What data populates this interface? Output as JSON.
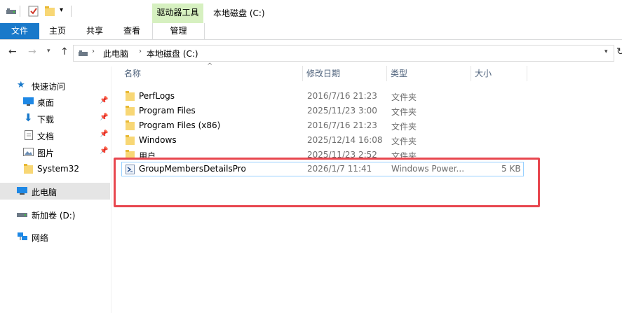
{
  "ribbon": {
    "context_header": "驱动器工具",
    "tabs": [
      "文件",
      "主页",
      "共享",
      "查看"
    ],
    "context_tab": "管理"
  },
  "window": {
    "title": "本地磁盘 (C:)"
  },
  "address": {
    "crumbs": [
      "此电脑",
      "本地磁盘 (C:)"
    ]
  },
  "nav": {
    "quick_access": "快速访问",
    "items": [
      {
        "label": "桌面",
        "icon": "desktop-icon",
        "pinned": true
      },
      {
        "label": "下载",
        "icon": "download-icon",
        "pinned": true
      },
      {
        "label": "文档",
        "icon": "documents-icon",
        "pinned": true
      },
      {
        "label": "图片",
        "icon": "pictures-icon",
        "pinned": true
      },
      {
        "label": "System32",
        "icon": "folder-icon",
        "pinned": false
      }
    ],
    "this_pc": "此电脑",
    "drive_d": "新加卷 (D:)",
    "network": "网络"
  },
  "columns": {
    "name": "名称",
    "modified": "修改日期",
    "type": "类型",
    "size": "大小"
  },
  "files": [
    {
      "name": "PerfLogs",
      "modified": "2016/7/16 21:23",
      "type": "文件夹",
      "size": ""
    },
    {
      "name": "Program Files",
      "modified": "2025/11/23 3:00",
      "type": "文件夹",
      "size": ""
    },
    {
      "name": "Program Files (x86)",
      "modified": "2016/7/16 21:23",
      "type": "文件夹",
      "size": ""
    },
    {
      "name": "Windows",
      "modified": "2025/12/14 16:08",
      "type": "文件夹",
      "size": ""
    },
    {
      "name": "用户",
      "modified": "2025/11/23 2:52",
      "type": "文件夹",
      "size": ""
    },
    {
      "name": "GroupMembersDetailsPro",
      "modified": "2026/1/7 11:41",
      "type": "Windows Power...",
      "size": "5 KB"
    }
  ],
  "colors": {
    "accent": "#1979ca",
    "context_tab": "#d6f0c0",
    "highlight_box": "#e8474f",
    "column_header": "#4c607a"
  }
}
